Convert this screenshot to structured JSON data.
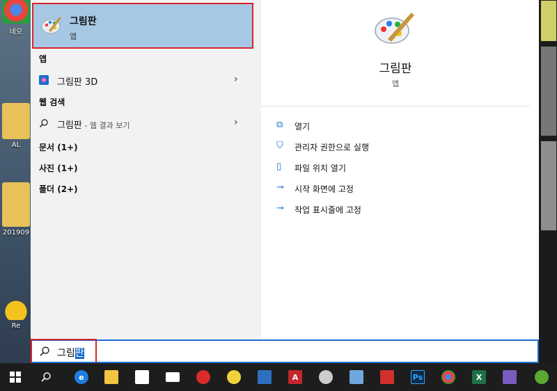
{
  "desktop": {
    "icons": [
      {
        "label": "네오"
      },
      {
        "label": "AL"
      },
      {
        "label": "201909"
      },
      {
        "label": "Re"
      }
    ]
  },
  "best_match": {
    "title": "그림판",
    "subtitle": "앱"
  },
  "sections": {
    "apps": "앱",
    "web": "웹 검색",
    "documents": "문서 (1+)",
    "photos": "사진 (1+)",
    "folders": "폴더 (2+)"
  },
  "apps_list": [
    {
      "label": "그림판 3D"
    }
  ],
  "web_result": {
    "query": "그림판",
    "suffix": " - 웹 결과 보기"
  },
  "detail": {
    "title": "그림판",
    "subtitle": "앱",
    "actions": [
      {
        "label": "열기",
        "icon": "open-icon"
      },
      {
        "label": "관리자 권한으로 실행",
        "icon": "shield-icon"
      },
      {
        "label": "파일 위치 열기",
        "icon": "file-location-icon"
      },
      {
        "label": "시작 화면에 고정",
        "icon": "pin-icon"
      },
      {
        "label": "작업 표시줄에 고정",
        "icon": "pin-icon"
      }
    ]
  },
  "search": {
    "typed": "그림",
    "selected": "판"
  },
  "taskbar": {
    "apps": [
      {
        "name": "start",
        "color": "#ffffff"
      },
      {
        "name": "search",
        "color": "#ffffff"
      },
      {
        "name": "edge",
        "color": "#1e7de0"
      },
      {
        "name": "file-explorer",
        "color": "#f4c542"
      },
      {
        "name": "store",
        "color": "#ffffff"
      },
      {
        "name": "mail",
        "color": "#ffffff"
      },
      {
        "name": "red-app",
        "color": "#d92b2b"
      },
      {
        "name": "penguin-app",
        "color": "#f2d23c"
      },
      {
        "name": "blue-app",
        "color": "#2e6fbf"
      },
      {
        "name": "autocad",
        "color": "#c1272d"
      },
      {
        "name": "qq",
        "color": "#cccccc"
      },
      {
        "name": "pencil-app",
        "color": "#6fa8dc"
      },
      {
        "name": "sketchup",
        "color": "#d0312d"
      },
      {
        "name": "photoshop",
        "color": "#0e2a47"
      },
      {
        "name": "chrome",
        "color": "#e8453c"
      },
      {
        "name": "excel",
        "color": "#1e7145"
      },
      {
        "name": "vs",
        "color": "#7a5bbf"
      },
      {
        "name": "green-app",
        "color": "#5aa832"
      }
    ]
  }
}
